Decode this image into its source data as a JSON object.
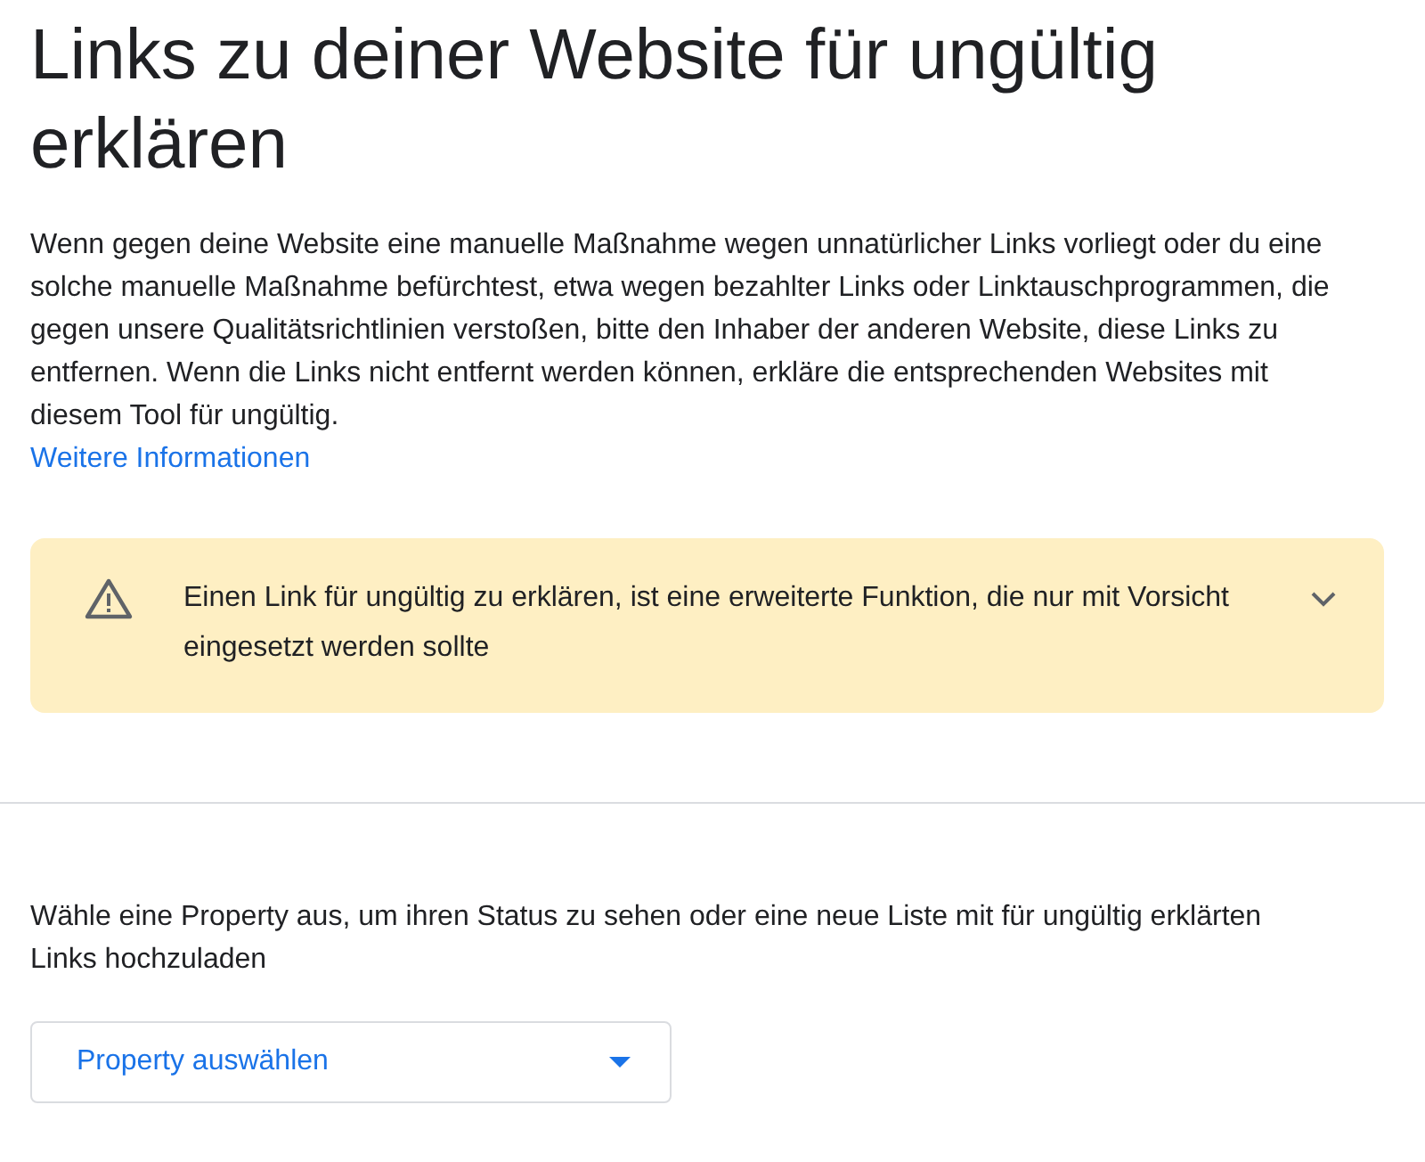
{
  "title": "Links zu deiner Website für ungültig erklären",
  "intro": {
    "text": "Wenn gegen deine Website eine manuelle Maßnahme wegen unnatürlicher Links vorliegt oder du eine solche manuelle Maßnahme befürchtest, etwa wegen bezahlter Links oder Linktauschprogrammen, die gegen unsere Qualitätsrichtlinien verstoßen, bitte den Inhaber der anderen Website, diese Links zu entfernen. Wenn die Links nicht entfernt werden können, erkläre die entsprechenden Websites mit diesem Tool für ungültig.",
    "link": "Weitere Informationen"
  },
  "warning": {
    "text": "Einen Link für ungültig zu erklären, ist eine erweiterte Funktion, die nur mit Vorsicht eingesetzt werden sollte",
    "expanded": false
  },
  "property_prompt": "Wähle eine Property aus, um ihren Status zu sehen oder eine neue Liste mit für ungültig erklärten Links hochzuladen",
  "property_select": {
    "placeholder": "Property auswählen"
  }
}
